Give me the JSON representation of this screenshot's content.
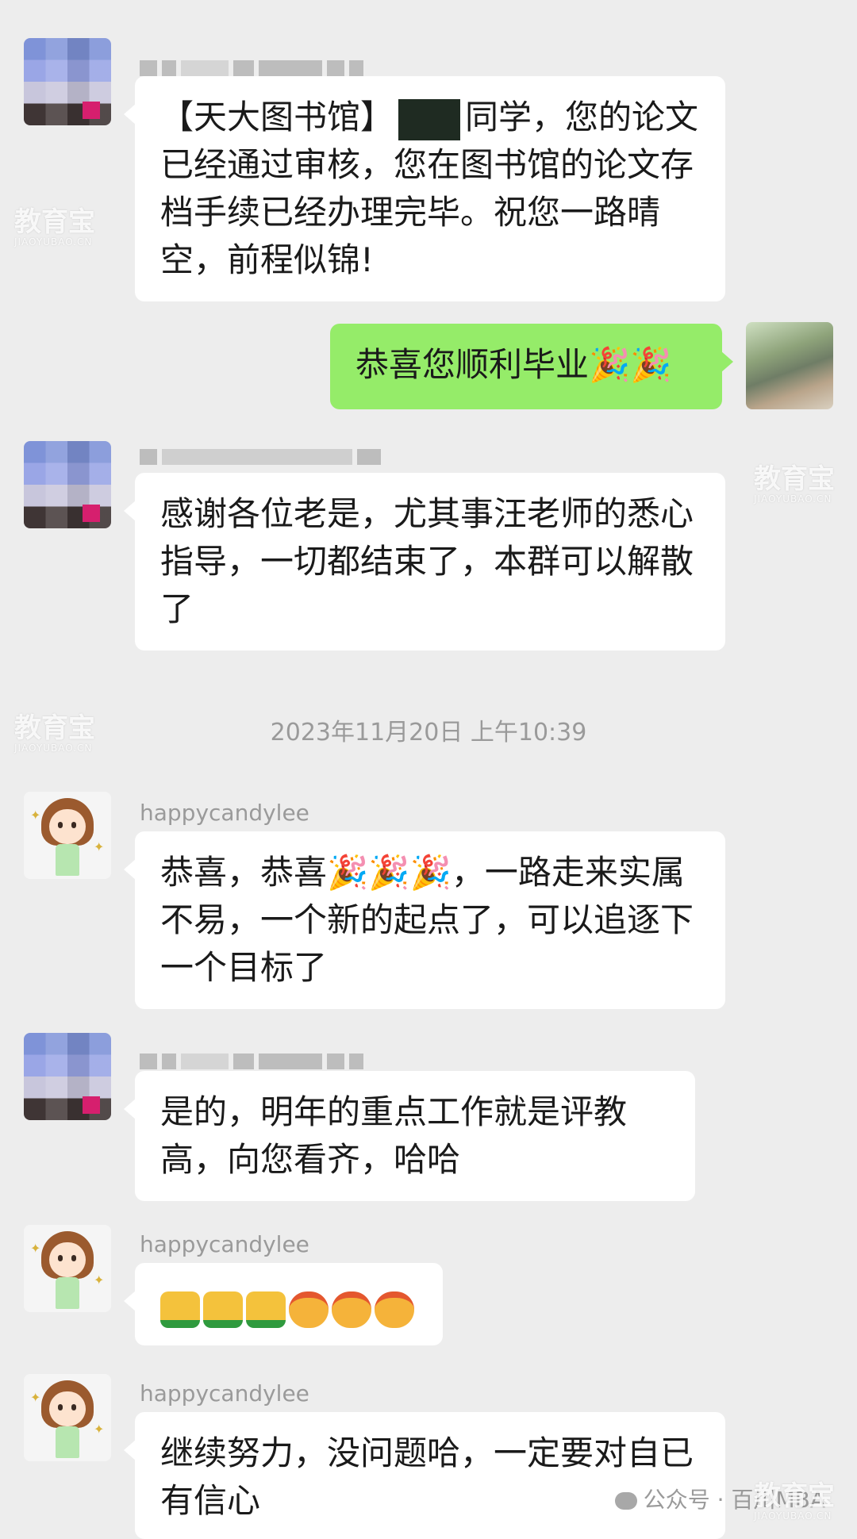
{
  "messages": [
    {
      "text_before": "【天大图书馆】",
      "text_after": "同学，您的论文已经通过审核，您在图书馆的论文存档手续已经办理完毕。祝您一路晴空，前程似锦!"
    },
    {
      "text": "恭喜您顺利毕业🎉🎉"
    },
    {
      "text": "感谢各位老是，尤其事汪老师的悉心指导，一切都结束了，本群可以解散了"
    },
    {
      "name": "happycandylee",
      "text": "恭喜，恭喜🎉🎉🎉，一路走来实属不易，一个新的起点了，可以追逐下一个目标了"
    },
    {
      "text": "是的，明年的重点工作就是评教高，向您看齐，哈哈"
    },
    {
      "name": "happycandylee"
    },
    {
      "name": "happycandylee",
      "text": "继续努力，没问题哈，一定要对自已有信心"
    }
  ],
  "timestamp": "2023年11月20日 上午10:39",
  "watermark": {
    "main": "教育宝",
    "sub": "JIAOYUBAO.CN"
  },
  "footer": {
    "text": "公众号 · 百川MBA"
  }
}
